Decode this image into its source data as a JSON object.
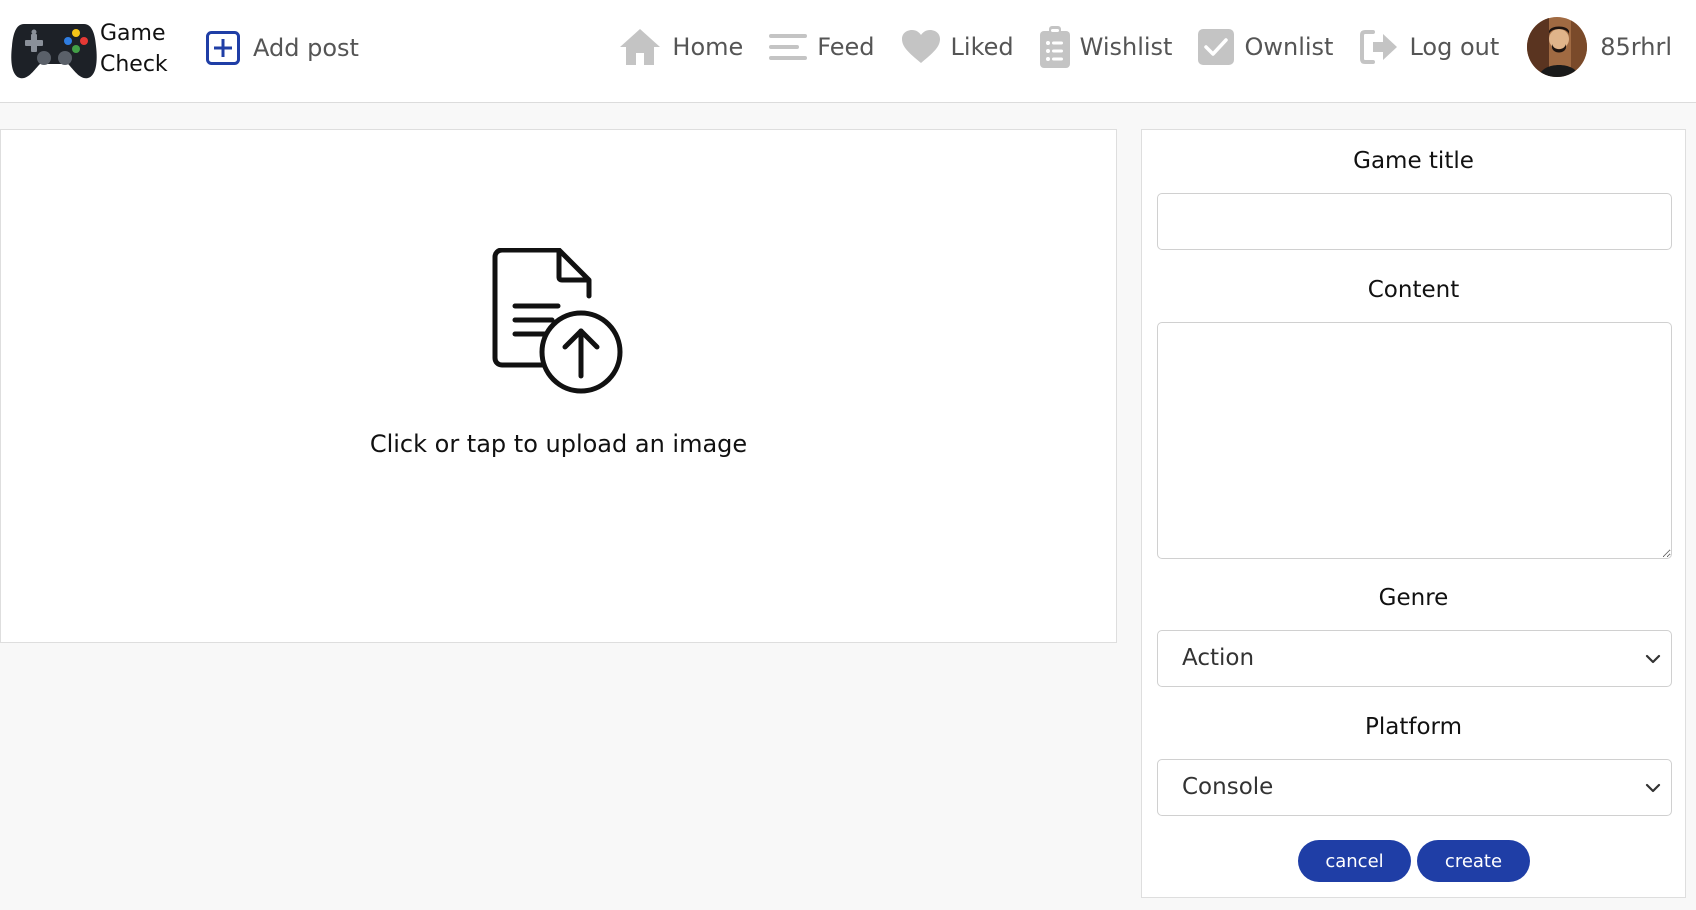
{
  "brand": {
    "line1": "Game",
    "line2": "Check"
  },
  "header": {
    "add_post_label": "Add post",
    "nav": [
      {
        "label": "Home",
        "icon": "home-icon"
      },
      {
        "label": "Feed",
        "icon": "feed-icon"
      },
      {
        "label": "Liked",
        "icon": "heart-icon"
      },
      {
        "label": "Wishlist",
        "icon": "clipboard-list-icon"
      },
      {
        "label": "Ownlist",
        "icon": "check-square-icon"
      },
      {
        "label": "Log out",
        "icon": "logout-icon"
      }
    ],
    "username": "85rhrl"
  },
  "upload": {
    "prompt": "Click or tap to upload an image",
    "icon": "file-upload-icon"
  },
  "form": {
    "title_label": "Game title",
    "title_value": "",
    "content_label": "Content",
    "content_value": "",
    "genre_label": "Genre",
    "genre_value": "Action",
    "platform_label": "Platform",
    "platform_value": "Console",
    "cancel_label": "cancel",
    "create_label": "create"
  },
  "colors": {
    "accent": "#1f3ea6",
    "nav_icon": "#c4c4c4",
    "nav_text": "#555555",
    "page_background": "#f8f8f8"
  }
}
